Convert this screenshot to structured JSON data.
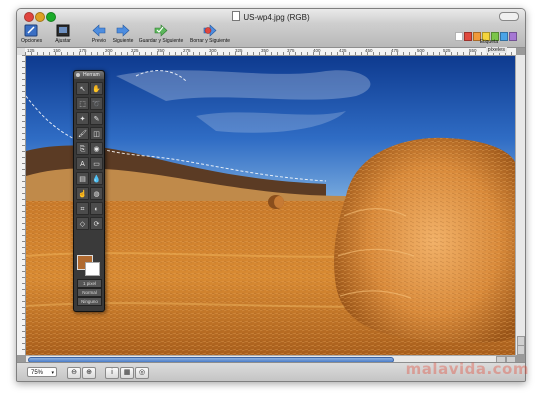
{
  "window": {
    "title": "US-wp4.jpg (RGB)"
  },
  "toolbar": {
    "buttons": [
      {
        "label": "Opciones",
        "icon": "options-icon"
      },
      {
        "label": "Ajustar",
        "icon": "adjust-icon"
      },
      {
        "label": "Previo",
        "icon": "back-arrow-icon"
      },
      {
        "label": "Siguiente",
        "icon": "forward-arrow-icon"
      },
      {
        "label": "Guardar y Siguiente",
        "icon": "save-next-icon"
      },
      {
        "label": "Borrar y Siguiente",
        "icon": "delete-next-icon"
      },
      {
        "label": "Etiqueta",
        "icon": "label-icon"
      }
    ],
    "label_colors": [
      "#9b9b9b",
      "#e04a3f",
      "#f19a3a",
      "#f4d43c",
      "#7bc54a",
      "#4aa3e6",
      "#a678d4",
      "#b0b0b0"
    ]
  },
  "rulers": {
    "h_numbers": [
      "125",
      "150",
      "175",
      "200",
      "225",
      "250",
      "275",
      "300",
      "325",
      "350",
      "375",
      "400",
      "425",
      "450",
      "475",
      "500",
      "525",
      "550"
    ],
    "unit": "píxeles"
  },
  "palette": {
    "title": "Herram",
    "tools": [
      "arrow-tool",
      "hand-tool",
      "marquee-tool",
      "lasso-tool",
      "magic-wand-tool",
      "pencil-tool",
      "brush-tool",
      "eraser-tool",
      "clone-tool",
      "bucket-tool",
      "text-tool",
      "shape-tool",
      "gradient-tool",
      "eyedropper-tool",
      "smudge-tool",
      "blur-tool",
      "crop-tool",
      "dodge-tool",
      "sharpen-tool",
      "rotate-tool"
    ],
    "size_value": "1 pixel",
    "mode_label": "Normal",
    "blend_label": "Ninguno"
  },
  "status": {
    "zoom": "75%"
  },
  "watermark": "malavida.com"
}
